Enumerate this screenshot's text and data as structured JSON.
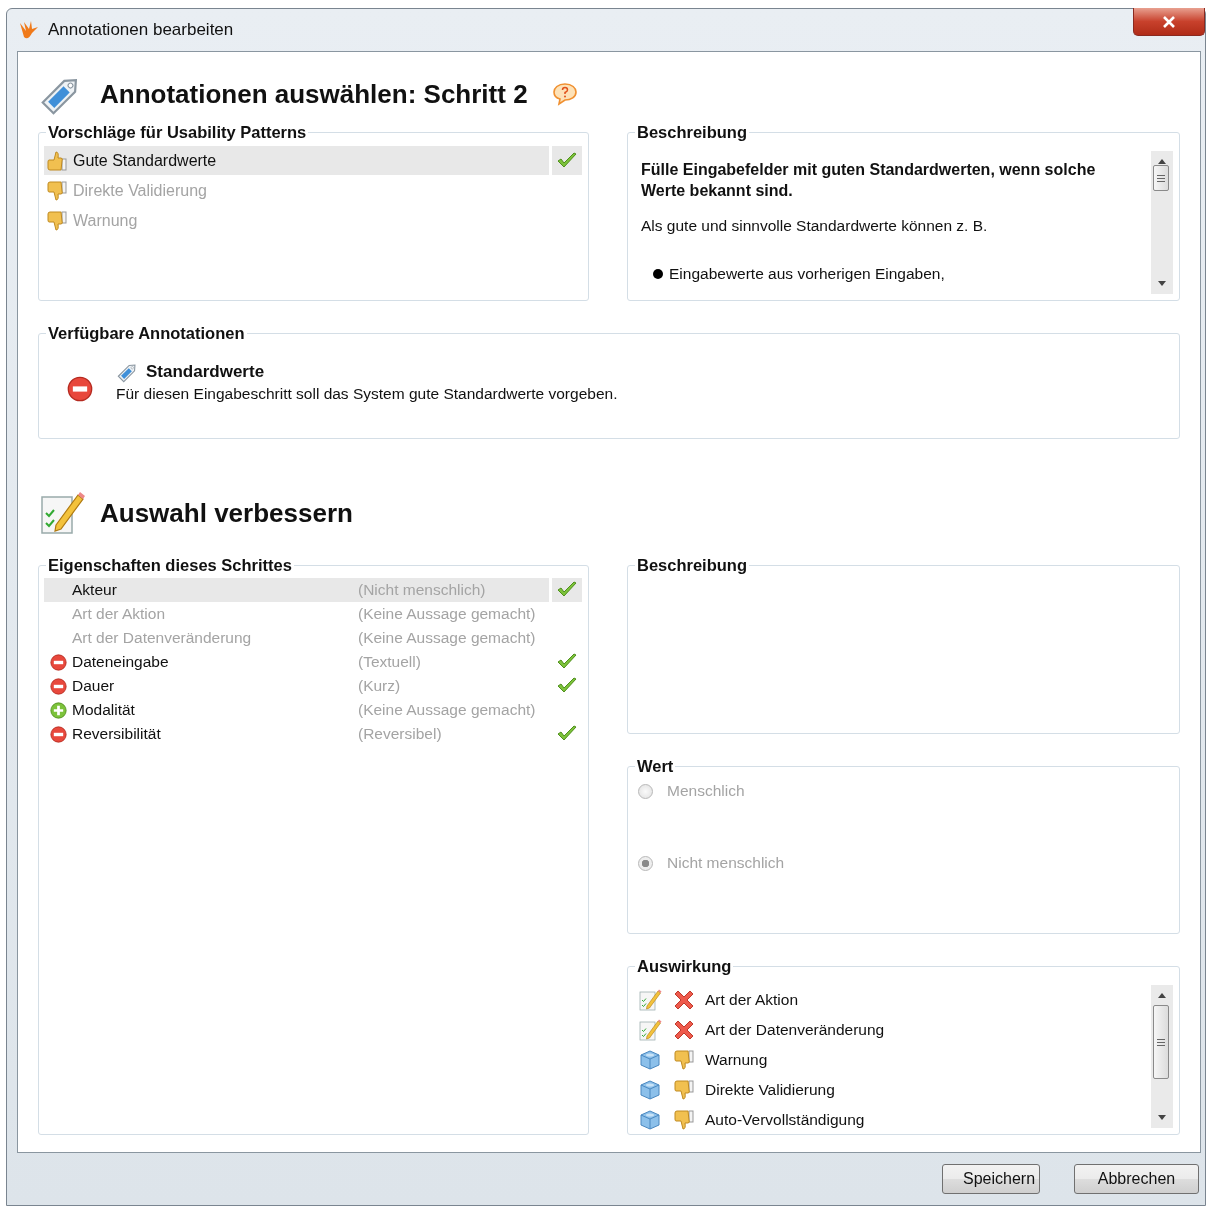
{
  "window": {
    "title": "Annotationen bearbeiten"
  },
  "step": {
    "title": "Annotationen auswählen: Schritt 2",
    "suggestions": {
      "title": "Vorschläge für Usability Patterns",
      "items": [
        {
          "label": "Gute Standardwerte",
          "kind": "up",
          "selected": true,
          "checked": true,
          "disabled": false
        },
        {
          "label": "Direkte Validierung",
          "kind": "down",
          "selected": false,
          "checked": false,
          "disabled": true
        },
        {
          "label": "Warnung",
          "kind": "down",
          "selected": false,
          "checked": false,
          "disabled": true
        }
      ]
    },
    "description": {
      "title": "Beschreibung",
      "heading": "Fülle Eingabefelder mit guten Standardwerten, wenn solche Werte bekannt sind.",
      "text": "Als gute und sinnvolle Standardwerte können z. B.",
      "bullets": [
        "Eingabewerte aus vorherigen Eingaben,"
      ]
    },
    "available": {
      "title": "Verfügbare Annotationen",
      "items": [
        {
          "kind": "remove",
          "name": "Standardwerte",
          "text": "Für diesen Eingabeschritt soll das System gute Standardwerte vorgeben."
        }
      ]
    }
  },
  "improve": {
    "title": "Auswahl verbessern",
    "properties": {
      "title": "Eigenschaften dieses Schrittes",
      "rows": [
        {
          "kind": "plain",
          "name": "Akteur",
          "value": "(Nicht menschlich)",
          "selected": true,
          "checked": true,
          "disabled": false
        },
        {
          "kind": "plain",
          "name": "Art der Aktion",
          "value": "(Keine Aussage gemacht)",
          "selected": false,
          "checked": false,
          "disabled": true
        },
        {
          "kind": "plain",
          "name": "Art der Datenveränderung",
          "value": "(Keine Aussage gemacht)",
          "selected": false,
          "checked": false,
          "disabled": true
        },
        {
          "kind": "remove",
          "name": "Dateneingabe",
          "value": "(Textuell)",
          "selected": false,
          "checked": true,
          "disabled": false
        },
        {
          "kind": "remove",
          "name": "Dauer",
          "value": "(Kurz)",
          "selected": false,
          "checked": true,
          "disabled": false
        },
        {
          "kind": "add",
          "name": "Modalität",
          "value": "(Keine Aussage gemacht)",
          "selected": false,
          "checked": false,
          "disabled": false
        },
        {
          "kind": "remove",
          "name": "Reversibilität",
          "value": "(Reversibel)",
          "selected": false,
          "checked": true,
          "disabled": false
        }
      ]
    },
    "description": {
      "title": "Beschreibung"
    },
    "value": {
      "title": "Wert",
      "options": [
        {
          "label": "Menschlich",
          "selected": false,
          "disabled": true
        },
        {
          "label": "Nicht menschlich",
          "selected": true,
          "disabled": true
        }
      ]
    },
    "effects": {
      "title": "Auswirkung",
      "items": [
        {
          "kind": "edit-rejected",
          "label": "Art der Aktion"
        },
        {
          "kind": "edit-rejected",
          "label": "Art der Datenveränderung"
        },
        {
          "kind": "pattern-negative",
          "label": "Warnung"
        },
        {
          "kind": "pattern-negative",
          "label": "Direkte Validierung"
        },
        {
          "kind": "pattern-negative",
          "label": "Auto-Vervollständigung"
        }
      ]
    }
  },
  "buttons": [
    {
      "label": "Speichern"
    },
    {
      "label": "Abbrechen"
    }
  ]
}
